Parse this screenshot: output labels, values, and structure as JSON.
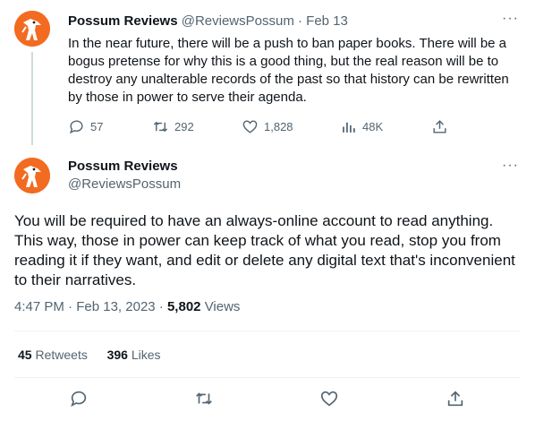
{
  "reply_to": {
    "name": "Possum Reviews",
    "handle": "@ReviewsPossum",
    "separator": "·",
    "date": "Feb 13",
    "more": "···",
    "text": "In the near future, there will be a push to ban paper books. There will be a bogus pretense for why this is a good thing, but the real reason will be to destroy any unalterable records of the past so that history can be rewritten by those in power to serve their agenda.",
    "replies": "57",
    "retweets": "292",
    "likes": "1,828",
    "views": "48K"
  },
  "tweet": {
    "name": "Possum Reviews",
    "handle": "@ReviewsPossum",
    "more": "···",
    "text": "You will be required to have an always-online account to read anything. This way, those in power can keep track of what you read, stop you from reading it if they want, and edit or delete any digital text that's inconvenient to their narratives.",
    "time": "4:47 PM",
    "separator": "·",
    "date": "Feb 13, 2023",
    "views_count": "5,802",
    "views_label": "Views",
    "retweets_count": "45",
    "retweets_label": "Retweets",
    "likes_count": "396",
    "likes_label": "Likes"
  },
  "colors": {
    "accent": "#f26b21",
    "muted": "#536471",
    "text": "#0f1419",
    "border": "#eff3f4"
  }
}
